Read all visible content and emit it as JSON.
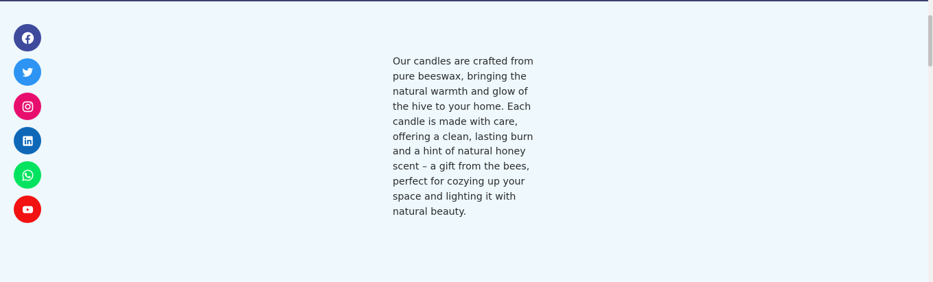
{
  "social": [
    {
      "icon": "facebook-icon",
      "color": "#3e4a9c"
    },
    {
      "icon": "twitter-icon",
      "color": "#2d94f3"
    },
    {
      "icon": "instagram-icon",
      "color": "#e80e6e"
    },
    {
      "icon": "linkedin-icon",
      "color": "#0e68b7"
    },
    {
      "icon": "whatsapp-icon",
      "color": "#04e35f"
    },
    {
      "icon": "youtube-icon",
      "color": "#f21212"
    }
  ],
  "content": {
    "paragraph": "Our candles are crafted from pure beeswax, bringing the natural warmth and glow of the hive to your home. Each candle is made with care, offering a clean, lasting burn and a hint of natural honey scent – a gift from the bees, perfect for cozying up your space and lighting it with natural beauty."
  },
  "colors": {
    "background": "#eef8fd",
    "top_bar": "#3c3f6e",
    "text": "#2b2b2b"
  }
}
